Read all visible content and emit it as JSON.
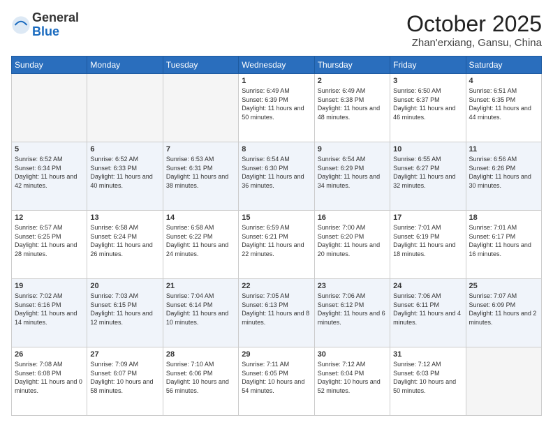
{
  "header": {
    "logo_general": "General",
    "logo_blue": "Blue",
    "month": "October 2025",
    "location": "Zhan'erxiang, Gansu, China"
  },
  "days_of_week": [
    "Sunday",
    "Monday",
    "Tuesday",
    "Wednesday",
    "Thursday",
    "Friday",
    "Saturday"
  ],
  "weeks": [
    [
      {
        "day": "",
        "sunrise": "",
        "sunset": "",
        "daylight": ""
      },
      {
        "day": "",
        "sunrise": "",
        "sunset": "",
        "daylight": ""
      },
      {
        "day": "",
        "sunrise": "",
        "sunset": "",
        "daylight": ""
      },
      {
        "day": "1",
        "sunrise": "Sunrise: 6:49 AM",
        "sunset": "Sunset: 6:39 PM",
        "daylight": "Daylight: 11 hours and 50 minutes."
      },
      {
        "day": "2",
        "sunrise": "Sunrise: 6:49 AM",
        "sunset": "Sunset: 6:38 PM",
        "daylight": "Daylight: 11 hours and 48 minutes."
      },
      {
        "day": "3",
        "sunrise": "Sunrise: 6:50 AM",
        "sunset": "Sunset: 6:37 PM",
        "daylight": "Daylight: 11 hours and 46 minutes."
      },
      {
        "day": "4",
        "sunrise": "Sunrise: 6:51 AM",
        "sunset": "Sunset: 6:35 PM",
        "daylight": "Daylight: 11 hours and 44 minutes."
      }
    ],
    [
      {
        "day": "5",
        "sunrise": "Sunrise: 6:52 AM",
        "sunset": "Sunset: 6:34 PM",
        "daylight": "Daylight: 11 hours and 42 minutes."
      },
      {
        "day": "6",
        "sunrise": "Sunrise: 6:52 AM",
        "sunset": "Sunset: 6:33 PM",
        "daylight": "Daylight: 11 hours and 40 minutes."
      },
      {
        "day": "7",
        "sunrise": "Sunrise: 6:53 AM",
        "sunset": "Sunset: 6:31 PM",
        "daylight": "Daylight: 11 hours and 38 minutes."
      },
      {
        "day": "8",
        "sunrise": "Sunrise: 6:54 AM",
        "sunset": "Sunset: 6:30 PM",
        "daylight": "Daylight: 11 hours and 36 minutes."
      },
      {
        "day": "9",
        "sunrise": "Sunrise: 6:54 AM",
        "sunset": "Sunset: 6:29 PM",
        "daylight": "Daylight: 11 hours and 34 minutes."
      },
      {
        "day": "10",
        "sunrise": "Sunrise: 6:55 AM",
        "sunset": "Sunset: 6:27 PM",
        "daylight": "Daylight: 11 hours and 32 minutes."
      },
      {
        "day": "11",
        "sunrise": "Sunrise: 6:56 AM",
        "sunset": "Sunset: 6:26 PM",
        "daylight": "Daylight: 11 hours and 30 minutes."
      }
    ],
    [
      {
        "day": "12",
        "sunrise": "Sunrise: 6:57 AM",
        "sunset": "Sunset: 6:25 PM",
        "daylight": "Daylight: 11 hours and 28 minutes."
      },
      {
        "day": "13",
        "sunrise": "Sunrise: 6:58 AM",
        "sunset": "Sunset: 6:24 PM",
        "daylight": "Daylight: 11 hours and 26 minutes."
      },
      {
        "day": "14",
        "sunrise": "Sunrise: 6:58 AM",
        "sunset": "Sunset: 6:22 PM",
        "daylight": "Daylight: 11 hours and 24 minutes."
      },
      {
        "day": "15",
        "sunrise": "Sunrise: 6:59 AM",
        "sunset": "Sunset: 6:21 PM",
        "daylight": "Daylight: 11 hours and 22 minutes."
      },
      {
        "day": "16",
        "sunrise": "Sunrise: 7:00 AM",
        "sunset": "Sunset: 6:20 PM",
        "daylight": "Daylight: 11 hours and 20 minutes."
      },
      {
        "day": "17",
        "sunrise": "Sunrise: 7:01 AM",
        "sunset": "Sunset: 6:19 PM",
        "daylight": "Daylight: 11 hours and 18 minutes."
      },
      {
        "day": "18",
        "sunrise": "Sunrise: 7:01 AM",
        "sunset": "Sunset: 6:17 PM",
        "daylight": "Daylight: 11 hours and 16 minutes."
      }
    ],
    [
      {
        "day": "19",
        "sunrise": "Sunrise: 7:02 AM",
        "sunset": "Sunset: 6:16 PM",
        "daylight": "Daylight: 11 hours and 14 minutes."
      },
      {
        "day": "20",
        "sunrise": "Sunrise: 7:03 AM",
        "sunset": "Sunset: 6:15 PM",
        "daylight": "Daylight: 11 hours and 12 minutes."
      },
      {
        "day": "21",
        "sunrise": "Sunrise: 7:04 AM",
        "sunset": "Sunset: 6:14 PM",
        "daylight": "Daylight: 11 hours and 10 minutes."
      },
      {
        "day": "22",
        "sunrise": "Sunrise: 7:05 AM",
        "sunset": "Sunset: 6:13 PM",
        "daylight": "Daylight: 11 hours and 8 minutes."
      },
      {
        "day": "23",
        "sunrise": "Sunrise: 7:06 AM",
        "sunset": "Sunset: 6:12 PM",
        "daylight": "Daylight: 11 hours and 6 minutes."
      },
      {
        "day": "24",
        "sunrise": "Sunrise: 7:06 AM",
        "sunset": "Sunset: 6:11 PM",
        "daylight": "Daylight: 11 hours and 4 minutes."
      },
      {
        "day": "25",
        "sunrise": "Sunrise: 7:07 AM",
        "sunset": "Sunset: 6:09 PM",
        "daylight": "Daylight: 11 hours and 2 minutes."
      }
    ],
    [
      {
        "day": "26",
        "sunrise": "Sunrise: 7:08 AM",
        "sunset": "Sunset: 6:08 PM",
        "daylight": "Daylight: 11 hours and 0 minutes."
      },
      {
        "day": "27",
        "sunrise": "Sunrise: 7:09 AM",
        "sunset": "Sunset: 6:07 PM",
        "daylight": "Daylight: 10 hours and 58 minutes."
      },
      {
        "day": "28",
        "sunrise": "Sunrise: 7:10 AM",
        "sunset": "Sunset: 6:06 PM",
        "daylight": "Daylight: 10 hours and 56 minutes."
      },
      {
        "day": "29",
        "sunrise": "Sunrise: 7:11 AM",
        "sunset": "Sunset: 6:05 PM",
        "daylight": "Daylight: 10 hours and 54 minutes."
      },
      {
        "day": "30",
        "sunrise": "Sunrise: 7:12 AM",
        "sunset": "Sunset: 6:04 PM",
        "daylight": "Daylight: 10 hours and 52 minutes."
      },
      {
        "day": "31",
        "sunrise": "Sunrise: 7:12 AM",
        "sunset": "Sunset: 6:03 PM",
        "daylight": "Daylight: 10 hours and 50 minutes."
      },
      {
        "day": "",
        "sunrise": "",
        "sunset": "",
        "daylight": ""
      }
    ]
  ]
}
